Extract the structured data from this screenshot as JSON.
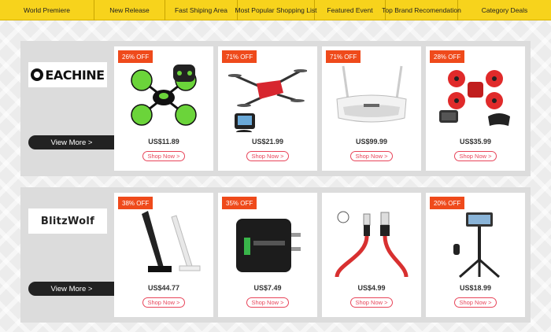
{
  "nav": {
    "items": [
      {
        "label": "World Premiere"
      },
      {
        "label": "New Release"
      },
      {
        "label": "Fast Shiping Area"
      },
      {
        "label": "Most Popular Shopping List"
      },
      {
        "label": "Featured Event"
      },
      {
        "label": "Top Brand Recomendation"
      },
      {
        "label": "Category Deals"
      }
    ]
  },
  "colors": {
    "nav_bg": "#f7d31c",
    "badge": "#ef4a1b",
    "shop_button": "#e8455a",
    "view_more_bg": "#222222"
  },
  "brands": [
    {
      "logo_text": "EACHINE",
      "view_more": "View More >",
      "products": [
        {
          "discount": "26% OFF",
          "price": "US$11.89",
          "shop": "Shop Now >",
          "icon": "mini-quadcopter-drone"
        },
        {
          "discount": "71% OFF",
          "price": "US$21.99",
          "shop": "Shop Now >",
          "icon": "foldable-selfie-drone"
        },
        {
          "discount": "71% OFF",
          "price": "US$99.99",
          "shop": "Shop Now >",
          "icon": "fpv-goggles"
        },
        {
          "discount": "28% OFF",
          "price": "US$35.99",
          "shop": "Shop Now >",
          "icon": "fpv-racing-drone-kit"
        }
      ]
    },
    {
      "logo_text": "BlitzWolf",
      "view_more": "View More >",
      "products": [
        {
          "discount": "38% OFF",
          "price": "US$44.77",
          "shop": "Shop Now >",
          "icon": "desk-lamp"
        },
        {
          "discount": "35% OFF",
          "price": "US$7.49",
          "shop": "Shop Now >",
          "icon": "usb-wall-charger"
        },
        {
          "discount": "",
          "price": "US$4.99",
          "shop": "Shop Now >",
          "icon": "usb-c-cable"
        },
        {
          "discount": "20% OFF",
          "price": "US$18.99",
          "shop": "Shop Now >",
          "icon": "selfie-stick-tripod"
        }
      ]
    }
  ]
}
